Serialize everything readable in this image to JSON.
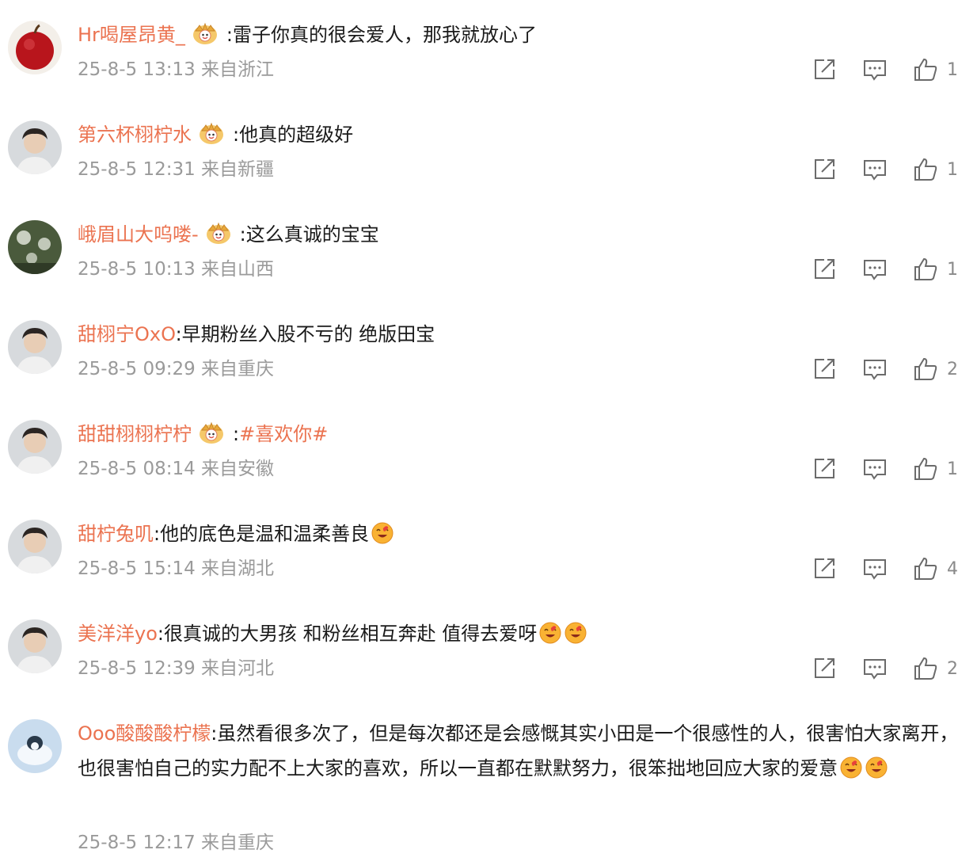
{
  "comments": [
    {
      "user": "Hr喝屋昂黄_",
      "crown": true,
      "sep": ":",
      "text": "雷子你真的很会爱人，那我就放心了",
      "tag": "",
      "emoji": 0,
      "time": "25-8-5 13:13",
      "loc": "来自浙江",
      "likes": "1",
      "avatar": "apple"
    },
    {
      "user": "第六杯栩柠水",
      "crown": true,
      "sep": ":",
      "text": "他真的超级好",
      "tag": "",
      "emoji": 0,
      "time": "25-8-5 12:31",
      "loc": "来自新疆",
      "likes": "1",
      "avatar": "person"
    },
    {
      "user": "峨眉山大呜喽-",
      "crown": true,
      "sep": ":",
      "text": "这么真诚的宝宝",
      "tag": "",
      "emoji": 0,
      "time": "25-8-5 10:13",
      "loc": "来自山西",
      "likes": "1",
      "avatar": "dandelion"
    },
    {
      "user": "甜栩宁OxO",
      "crown": false,
      "sep": ":",
      "text": "早期粉丝入股不亏的 绝版田宝",
      "tag": "",
      "emoji": 0,
      "time": "25-8-5 09:29",
      "loc": "来自重庆",
      "likes": "2",
      "avatar": "person"
    },
    {
      "user": "甜甜栩栩柠柠",
      "crown": true,
      "sep": ":",
      "text": "",
      "tag": "#喜欢你#",
      "emoji": 0,
      "time": "25-8-5 08:14",
      "loc": "来自安徽",
      "likes": "1",
      "avatar": "person"
    },
    {
      "user": "甜柠兔叽",
      "crown": false,
      "sep": ":",
      "text": "他的底色是温和温柔善良",
      "tag": "",
      "emoji": 1,
      "time": "25-8-5 15:14",
      "loc": "来自湖北",
      "likes": "4",
      "avatar": "person"
    },
    {
      "user": "美洋洋yo",
      "crown": false,
      "sep": ":",
      "text": "很真诚的大男孩 和粉丝相互奔赴 值得去爱呀",
      "tag": "",
      "emoji": 2,
      "time": "25-8-5 12:39",
      "loc": "来自河北",
      "likes": "2",
      "avatar": "person"
    },
    {
      "user": "Ooo酸酸酸柠檬",
      "crown": false,
      "sep": ":",
      "text": "虽然看很多次了，但是每次都还是会感慨其实小田是一个很感性的人，很害怕大家离开，也很害怕自己的实力配不上大家的喜欢，所以一直都在默默努力，很笨拙地回应大家的爱意",
      "tag": "",
      "emoji": 2,
      "time": "25-8-5 12:17",
      "loc": "来自重庆",
      "likes": "",
      "avatar": "snow"
    }
  ],
  "icons": {
    "share": "share-icon",
    "comment": "comment-icon",
    "like": "thumbs-up-icon",
    "crown": "crown-badge-icon"
  },
  "colors": {
    "username": "#eb7350",
    "meta": "#9a9a9a",
    "text": "#1a1a1a"
  }
}
